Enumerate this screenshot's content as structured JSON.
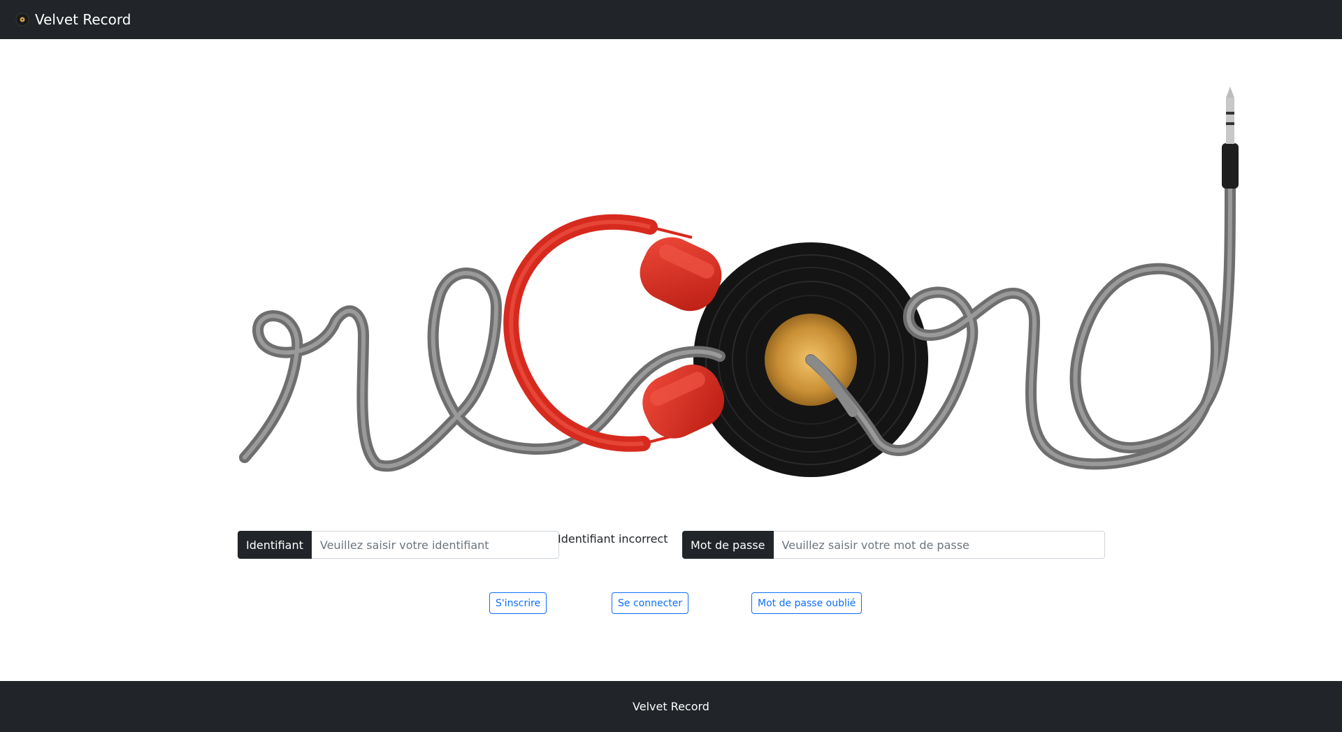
{
  "navbar": {
    "brand": "Velvet Record",
    "logo_icon": "vinyl-record-icon"
  },
  "form": {
    "username_label": "Identifiant",
    "username_placeholder": "Veuillez saisir votre identifiant",
    "username_value": "",
    "error_message": "Identifiant incorrect",
    "password_label": "Mot de passe",
    "password_placeholder": "Veuillez saisir votre mot de passe",
    "password_value": ""
  },
  "buttons": {
    "register": "S'inscrire",
    "login": "Se connecter",
    "forgot_password": "Mot de passe oublié"
  },
  "footer": {
    "text": "Velvet Record"
  },
  "colors": {
    "navbar_bg": "#212529",
    "accent": "#0d6efd",
    "headphones": "#e0281e",
    "vinyl": "#141414",
    "vinyl_label": "#d4a04a",
    "cable": "#7a7a7a"
  }
}
